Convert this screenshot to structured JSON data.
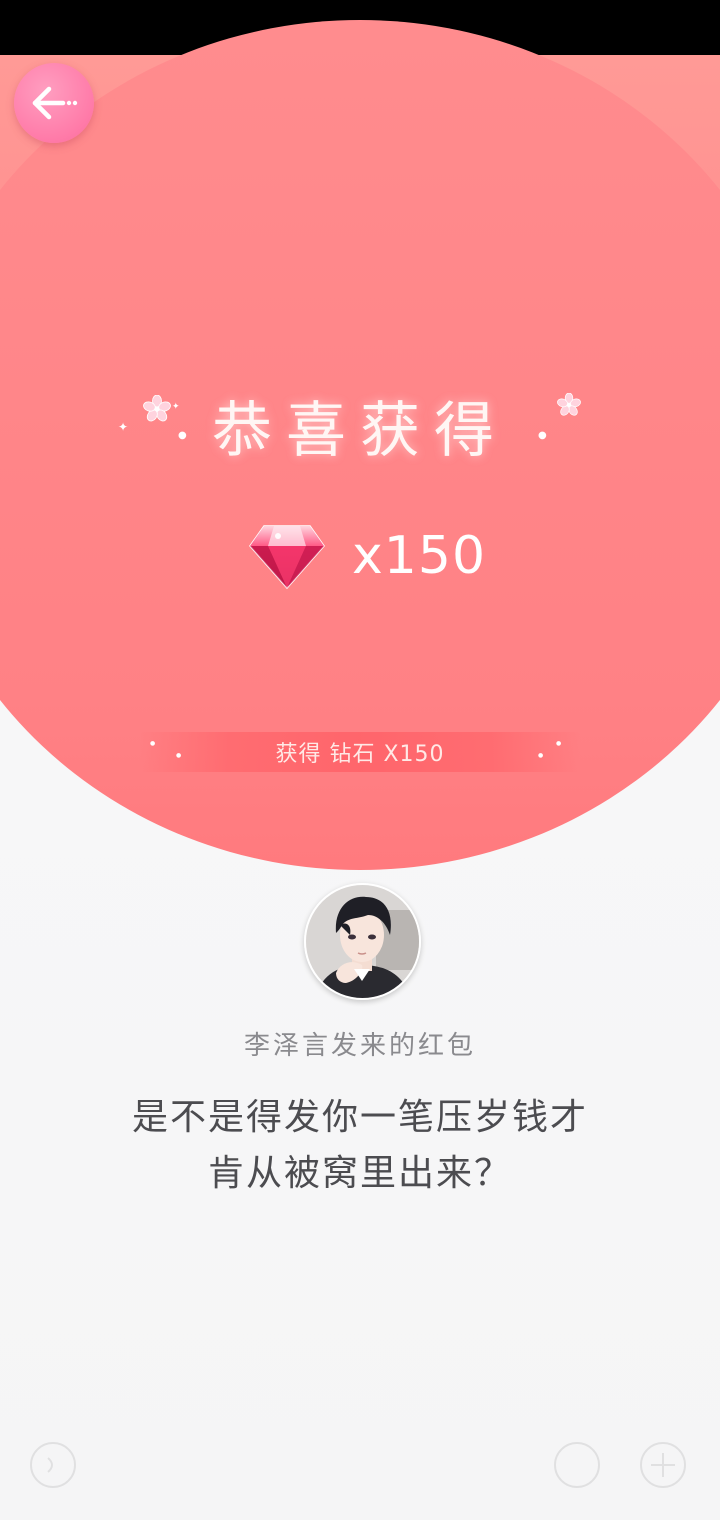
{
  "header": {
    "back_icon": "back-arrow-icon"
  },
  "reward": {
    "title": "恭喜获得",
    "gem_icon": "diamond-gem-icon",
    "quantity": "x150",
    "banner_text": "获得 钻石 X150"
  },
  "red_packet": {
    "sender": "李泽言发来的红包",
    "message_line1": "是不是得发你一笔压岁钱才",
    "message_line2": "肯从被窝里出来？"
  },
  "colors": {
    "primary_red": "#ff8185",
    "back_button_pink": "#ff7aa8",
    "background": "#f7f7f8"
  }
}
